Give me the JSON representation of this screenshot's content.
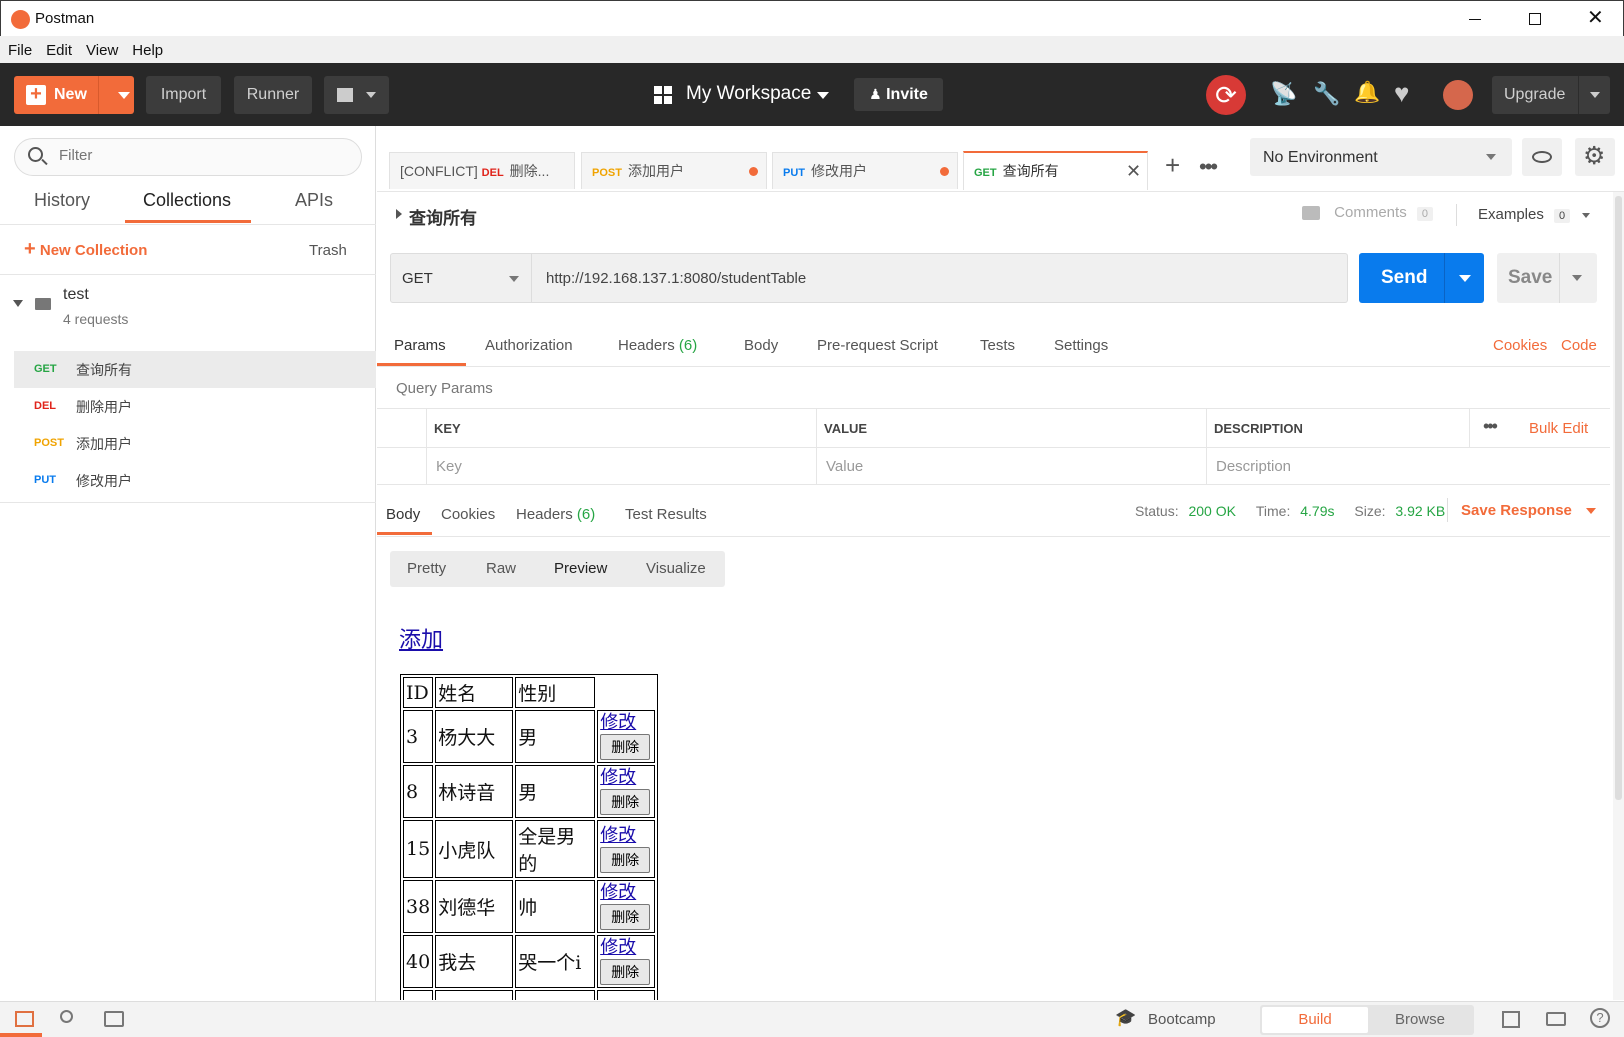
{
  "window": {
    "title": "Postman"
  },
  "menu": [
    "File",
    "Edit",
    "View",
    "Help"
  ],
  "header": {
    "new": "New",
    "import": "Import",
    "runner": "Runner",
    "workspace": "My Workspace",
    "invite": "Invite",
    "upgrade": "Upgrade"
  },
  "sidebar": {
    "filter_placeholder": "Filter",
    "tabs": [
      "History",
      "Collections",
      "APIs"
    ],
    "new_collection": "New Collection",
    "trash": "Trash",
    "collection": {
      "name": "test",
      "count": "4 requests"
    },
    "requests": [
      {
        "method": "GET",
        "name": "查询所有",
        "color": "#26a544"
      },
      {
        "method": "DEL",
        "name": "删除用户",
        "color": "#e0241b"
      },
      {
        "method": "POST",
        "name": "添加用户",
        "color": "#f0a300"
      },
      {
        "method": "PUT",
        "name": "修改用户",
        "color": "#097bed"
      }
    ]
  },
  "tabs": [
    {
      "prefix": "[CONFLICT]",
      "method": "DEL",
      "name": "删除...",
      "color": "#e0241b"
    },
    {
      "method": "POST",
      "name": "添加用户",
      "color": "#f0a300"
    },
    {
      "method": "PUT",
      "name": "修改用户",
      "color": "#097bed"
    },
    {
      "method": "GET",
      "name": "查询所有",
      "color": "#26a544"
    }
  ],
  "environment": "No Environment",
  "request": {
    "title": "查询所有",
    "comments": "Comments",
    "comments_count": "0",
    "examples": "Examples",
    "examples_count": "0",
    "method": "GET",
    "url": "http://192.168.137.1:8080/studentTable",
    "send": "Send",
    "save": "Save"
  },
  "req_tabs": {
    "params": "Params",
    "authorization": "Authorization",
    "headers": "Headers",
    "headers_count": "(6)",
    "body": "Body",
    "prerequest": "Pre-request Script",
    "tests": "Tests",
    "settings": "Settings",
    "cookies": "Cookies",
    "code": "Code"
  },
  "query": {
    "title": "Query Params",
    "key_h": "KEY",
    "value_h": "VALUE",
    "desc_h": "DESCRIPTION",
    "bulk": "Bulk Edit",
    "key_ph": "Key",
    "value_ph": "Value",
    "desc_ph": "Description"
  },
  "response": {
    "tabs": {
      "body": "Body",
      "cookies": "Cookies",
      "headers": "Headers",
      "headers_count": "(6)",
      "tests": "Test Results"
    },
    "status_label": "Status:",
    "status": "200 OK",
    "time_label": "Time:",
    "time": "4.79s",
    "size_label": "Size:",
    "size": "3.92 KB",
    "save": "Save Response",
    "views": [
      "Pretty",
      "Raw",
      "Preview",
      "Visualize"
    ]
  },
  "preview": {
    "add_link": "添加",
    "headers": [
      "ID",
      "姓名",
      "性别"
    ],
    "edit": "修改",
    "delete": "删除",
    "rows": [
      {
        "id": "3",
        "name": "杨大大",
        "gender": "男"
      },
      {
        "id": "8",
        "name": "林诗音",
        "gender": "男"
      },
      {
        "id": "15",
        "name": "小虎队",
        "gender": "全是男的"
      },
      {
        "id": "38",
        "name": "刘德华",
        "gender": "帅"
      },
      {
        "id": "40",
        "name": "我去",
        "gender": "哭一个i"
      }
    ]
  },
  "statusbar": {
    "bootcamp": "Bootcamp",
    "build": "Build",
    "browse": "Browse"
  }
}
